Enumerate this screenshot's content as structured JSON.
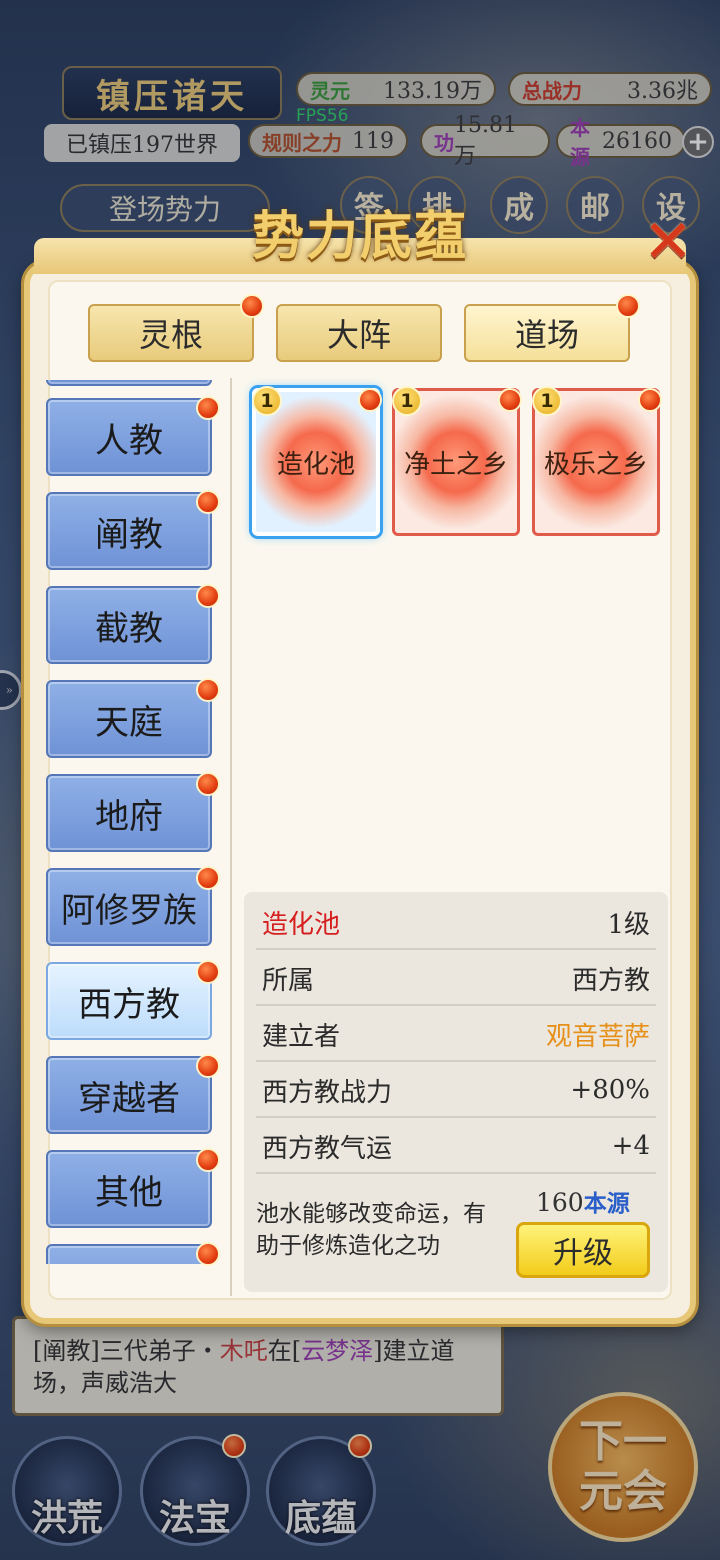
{
  "hud": {
    "title": "镇压诸天",
    "suppressed": "已镇压197世界",
    "fps": "FPS56",
    "stats": [
      {
        "label": "灵元",
        "value": "133.19万"
      },
      {
        "label": "总战力",
        "value": "3.36兆"
      },
      {
        "label": "规则之力",
        "value": "119"
      },
      {
        "label": "功",
        "value": "15.81万"
      },
      {
        "label": "本源",
        "value": "26160"
      }
    ],
    "debut_button": "登场势力",
    "top_icons": [
      "签",
      "排",
      "成",
      "邮",
      "设"
    ]
  },
  "modal": {
    "title": "势力底蕴",
    "close_icon": "close-x-icon",
    "tabs": [
      {
        "label": "灵根",
        "badge": true
      },
      {
        "label": "大阵",
        "badge": false
      },
      {
        "label": "道场",
        "badge": true,
        "active": true
      }
    ],
    "categories": [
      {
        "label": "人教"
      },
      {
        "label": "阐教"
      },
      {
        "label": "截教"
      },
      {
        "label": "天庭"
      },
      {
        "label": "地府"
      },
      {
        "label": "阿修罗族"
      },
      {
        "label": "西方教",
        "active": true
      },
      {
        "label": "穿越者"
      },
      {
        "label": "其他"
      }
    ],
    "cards": [
      {
        "name": "造化池",
        "level": "1",
        "selected": true
      },
      {
        "name": "净土之乡",
        "level": "1",
        "selected": false
      },
      {
        "name": "极乐之乡",
        "level": "1",
        "selected": false
      }
    ],
    "detail": {
      "name": "造化池",
      "level": "1级",
      "rows": [
        {
          "label": "所属",
          "value": "西方教"
        },
        {
          "label": "建立者",
          "value": "观音菩萨"
        },
        {
          "label": "西方教战力",
          "value": "+80%"
        },
        {
          "label": "西方教气运",
          "value": "+4"
        }
      ],
      "description": "池水能够改变命运，有助于修炼造化之功",
      "cost_amount": "160",
      "cost_resource": "本源",
      "upgrade_label": "升级"
    }
  },
  "log": {
    "prefix": "[阐教]三代弟子・",
    "name": "木吒",
    "mid": "在[",
    "place": "云梦泽",
    "suffix": "]建立道场，声威浩大"
  },
  "bottom_nav": [
    {
      "label": "洪荒",
      "badge": false
    },
    {
      "label": "法宝",
      "badge": true
    },
    {
      "label": "底蕴",
      "badge": true
    }
  ],
  "next_era": {
    "line1": "下一",
    "line2": "元会"
  },
  "colors": {
    "accent_gold": "#e7c879",
    "category_blue": "#6f92d6",
    "badge_red": "#e23c10",
    "highlight_red": "#d62020",
    "founder_orange": "#e6901a"
  }
}
